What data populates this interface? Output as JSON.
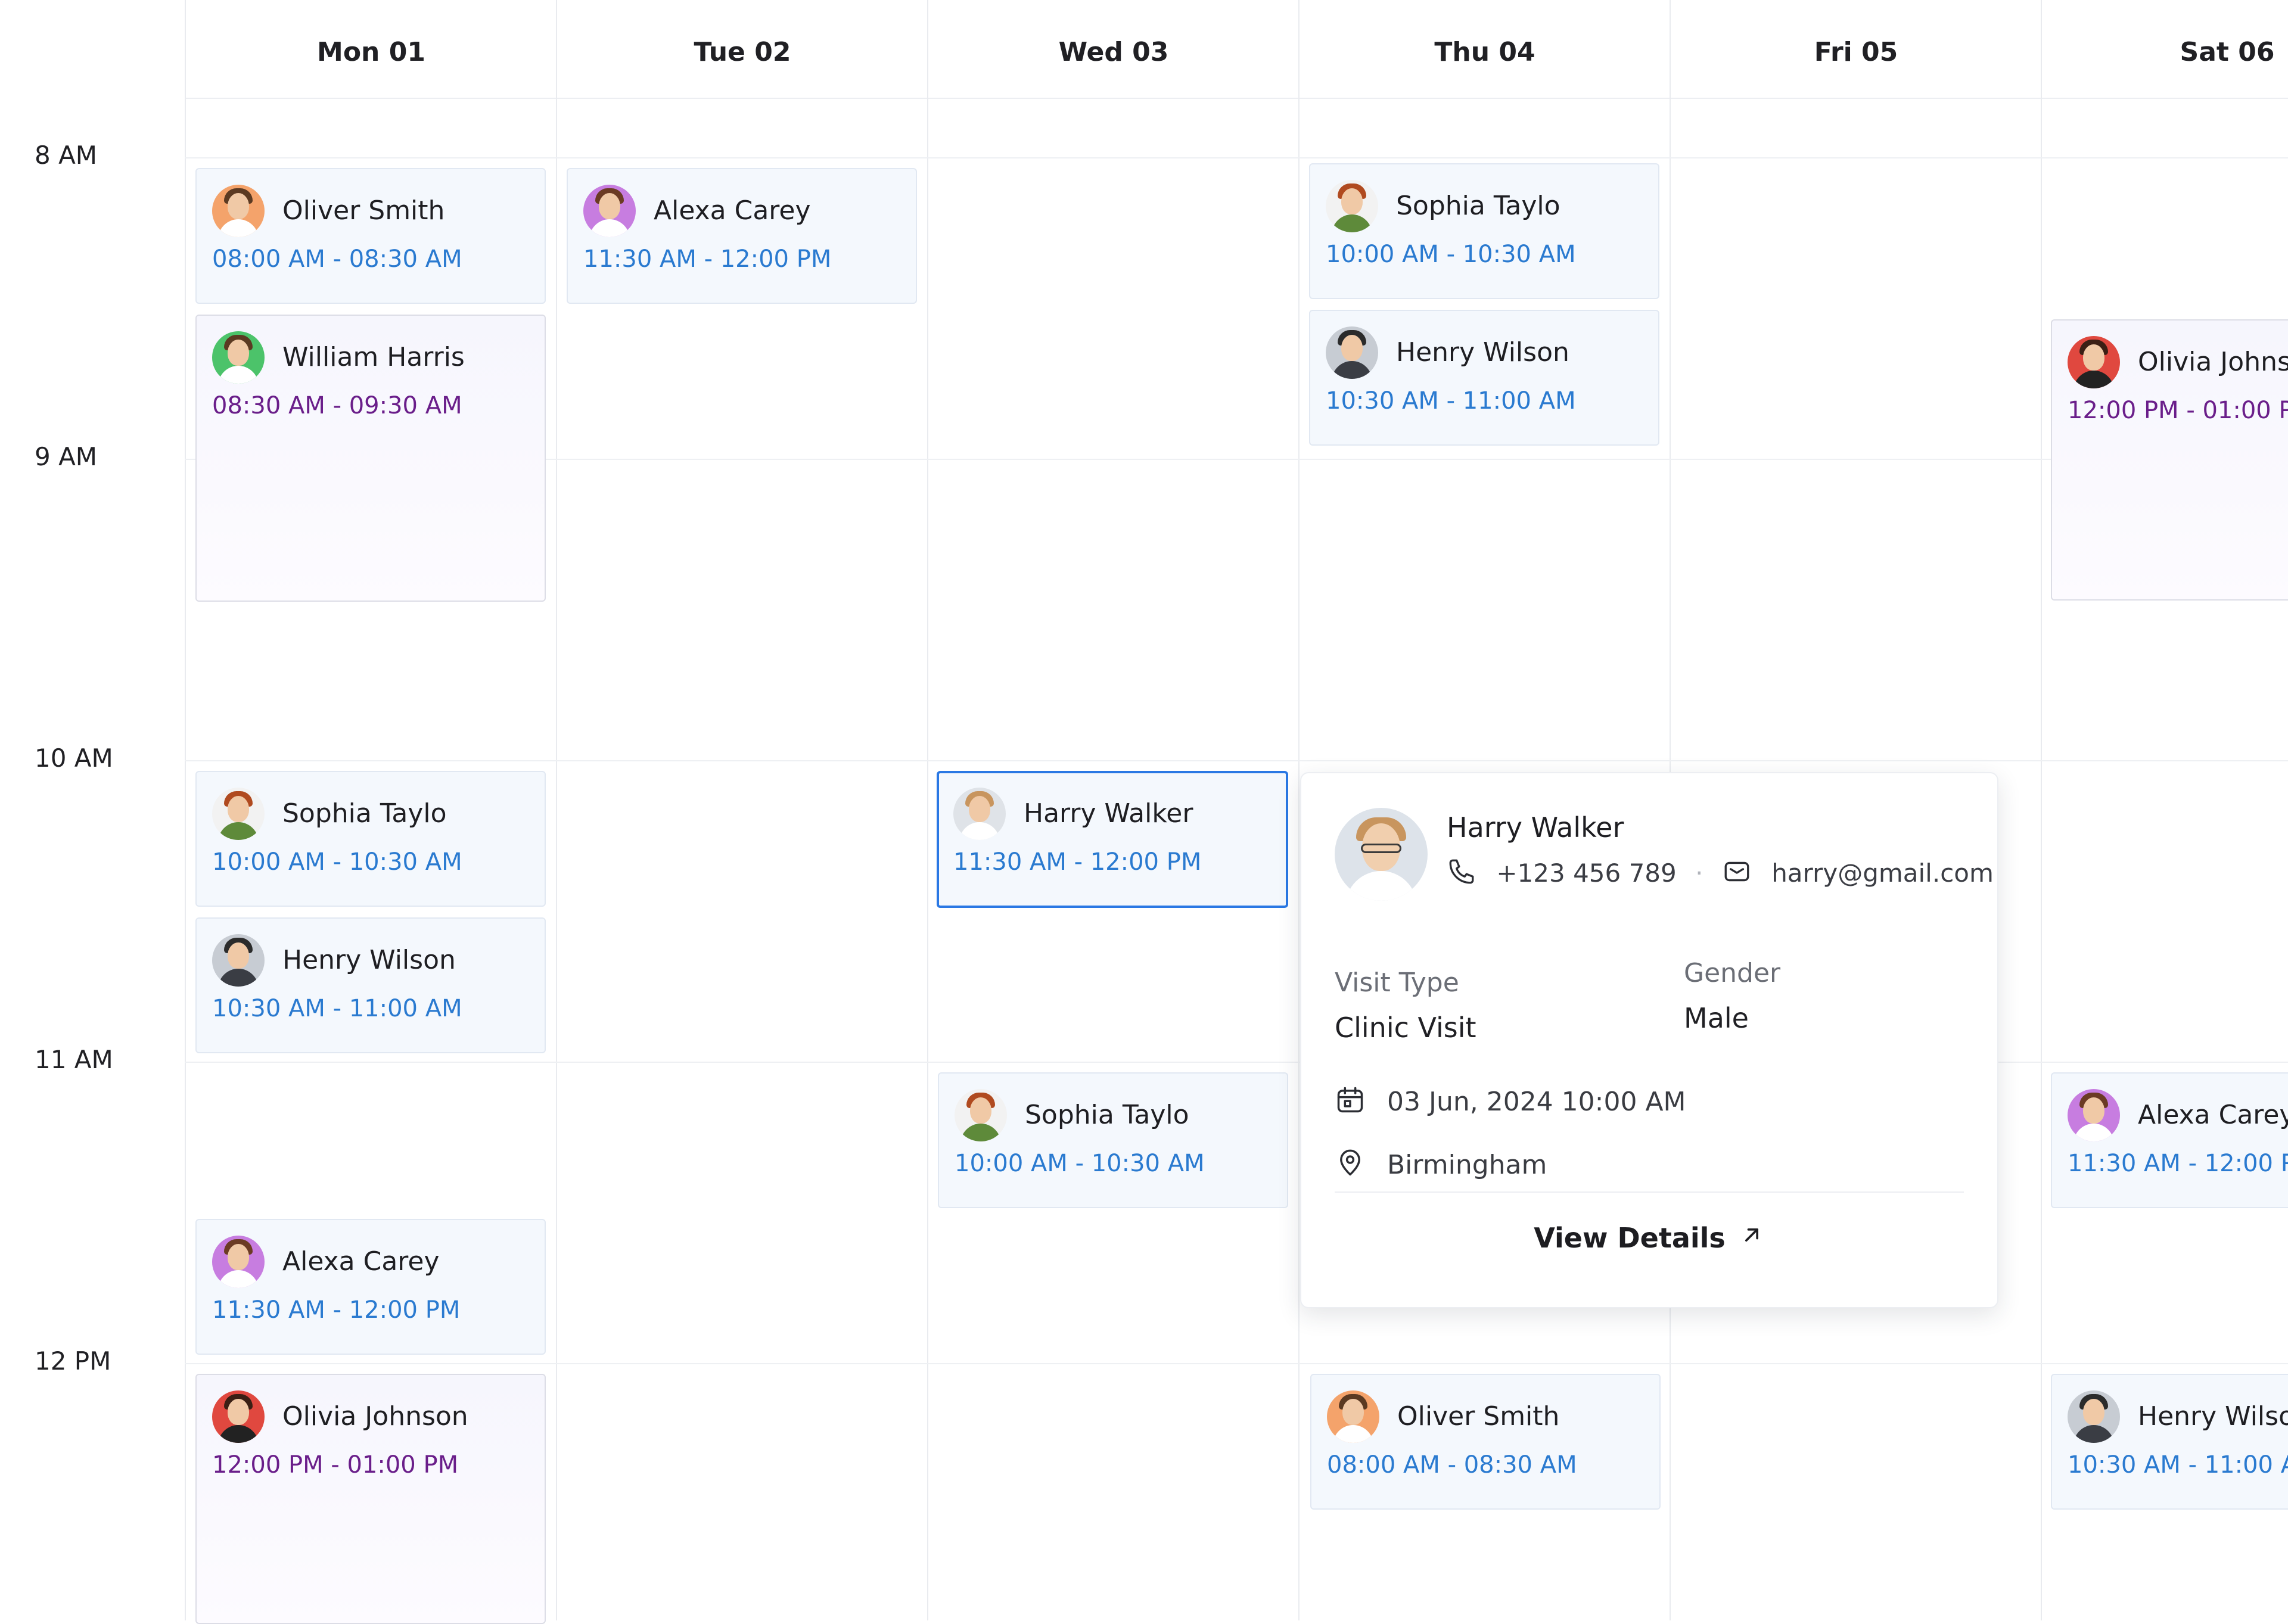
{
  "days": [
    "Mon 01",
    "Tue 02",
    "Wed 03",
    "Thu 04",
    "Fri 05",
    "Sat 06"
  ],
  "times": [
    "8 AM",
    "9 AM",
    "10 AM",
    "11 AM",
    "12 PM"
  ],
  "appointments": [
    {
      "name": "Oliver Smith",
      "time": "08:00 AM - 08:30 AM",
      "color": "blue",
      "avatar_bg": "#f4a36b"
    },
    {
      "name": "William Harris",
      "time": "08:30 AM - 09:30 AM",
      "color": "purple",
      "avatar_bg": "#4cc36a"
    },
    {
      "name": "Sophia Taylo",
      "time": "10:00 AM - 10:30 AM",
      "color": "blue",
      "avatar_bg": "#f2f2f2"
    },
    {
      "name": "Henry Wilson",
      "time": "10:30 AM - 11:00 AM",
      "color": "blue",
      "avatar_bg": "#c7ccd3"
    },
    {
      "name": "Alexa Carey",
      "time": "11:30 AM - 12:00 PM",
      "color": "blue",
      "avatar_bg": "#c77de0"
    },
    {
      "name": "Olivia Johnson",
      "time": "12:00 PM - 01:00 PM",
      "color": "purple",
      "avatar_bg": "#e0483f"
    },
    {
      "name": "Alexa Carey",
      "time": "11:30 AM - 12:00 PM",
      "color": "blue",
      "avatar_bg": "#c77de0"
    },
    {
      "name": "Harry Walker",
      "time": "11:30 AM - 12:00 PM",
      "color": "blue",
      "avatar_bg": "#dfe3e8"
    },
    {
      "name": "Sophia Taylo",
      "time": "10:00 AM - 10:30 AM",
      "color": "blue",
      "avatar_bg": "#f2f2f2"
    },
    {
      "name": "Sophia Taylo",
      "time": "10:00 AM - 10:30 AM",
      "color": "blue",
      "avatar_bg": "#f2f2f2"
    },
    {
      "name": "Henry Wilson",
      "time": "10:30 AM - 11:00 AM",
      "color": "blue",
      "avatar_bg": "#c7ccd3"
    },
    {
      "name": "Oliver Smith",
      "time": "08:00 AM - 08:30 AM",
      "color": "blue",
      "avatar_bg": "#f4a36b"
    },
    {
      "name": "Olivia Johns",
      "time": "12:00 PM - 01:00 P",
      "color": "purple",
      "avatar_bg": "#e0483f"
    },
    {
      "name": "Alexa Carey",
      "time": "11:30 AM - 12:00 PI",
      "color": "blue",
      "avatar_bg": "#c77de0"
    },
    {
      "name": "Henry Wilso",
      "time": "10:30 AM - 11:00 AI",
      "color": "blue",
      "avatar_bg": "#c7ccd3"
    }
  ],
  "popover": {
    "name": "Harry Walker",
    "phone": "+123 456 789",
    "email": "harry@gmail.com",
    "visit_type_label": "Visit Type",
    "visit_type": "Clinic Visit",
    "gender_label": "Gender",
    "gender": "Male",
    "datetime": "03 Jun, 2024 10:00 AM",
    "location": "Birmingham",
    "view_details": "View Details"
  },
  "colors": {
    "accent_blue": "#2a78e4",
    "time_blue": "#2a7ad0",
    "time_purple": "#6a1e8a"
  }
}
